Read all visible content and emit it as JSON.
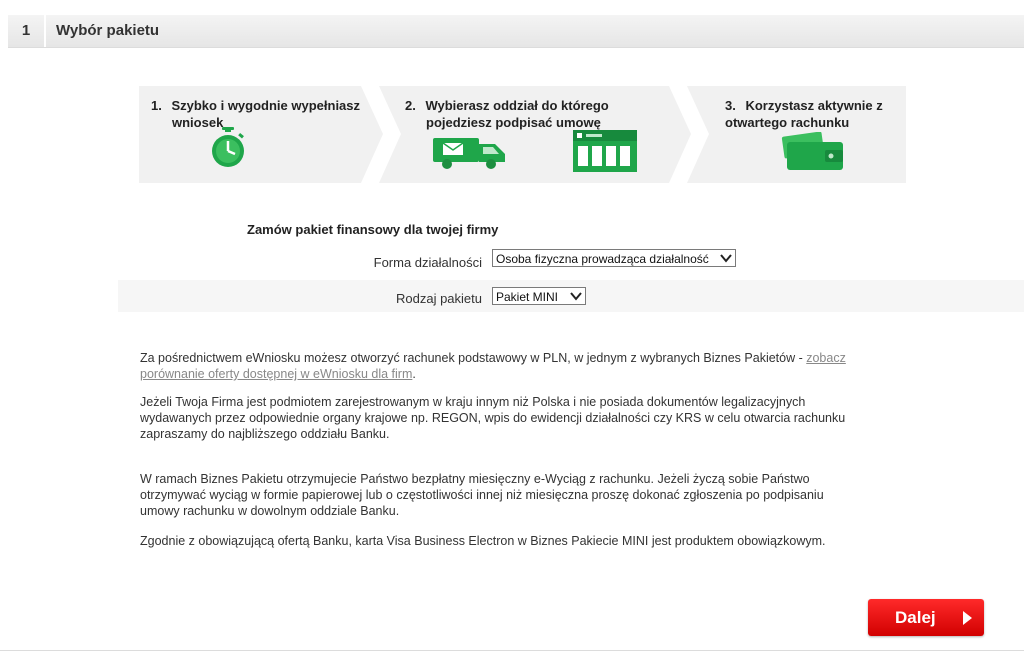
{
  "section": {
    "number": "1",
    "title": "Wybór pakietu"
  },
  "steps": [
    {
      "num": "1.",
      "line1": "Szybko i wygodnie wypełniasz",
      "line2": "wniosek"
    },
    {
      "num": "2.",
      "line1": "Wybierasz oddział do którego",
      "line2": "pojedziesz podpisać umowę"
    },
    {
      "num": "3.",
      "line1": "Korzystasz aktywnie z",
      "line2": "otwartego rachunku"
    }
  ],
  "form": {
    "title": "Zamów pakiet finansowy dla twojej firmy",
    "business_form_label": "Forma działalności",
    "business_form_value": "Osoba fizyczna prowadząca działalność",
    "package_label": "Rodzaj pakietu",
    "package_value": "Pakiet MINI"
  },
  "paragraphs": {
    "p1_text": "Za pośrednictwem eWniosku możesz otworzyć rachunek podstawowy w PLN, w jednym z wybranych Biznes Pakietów - ",
    "p1_link_a": "zobacz",
    "p1_link_b": "porównanie oferty dostępnej w eWniosku dla firm",
    "p1_end": ".",
    "p2_l1": "Jeżeli Twoja Firma jest podmiotem zarejestrowanym w kraju innym niż Polska i nie posiada dokumentów legalizacyjnych",
    "p2_l2": "wydawanych przez odpowiednie organy krajowe np. REGON, wpis do ewidencji działalności czy KRS w celu otwarcia rachunku",
    "p2_l3": "zapraszamy do najbliższego oddziału Banku.",
    "p3_l1": "W ramach Biznes Pakietu otrzymujecie Państwo bezpłatny miesięczny e-Wyciąg z rachunku. Jeżeli życzą sobie Państwo",
    "p3_l2": "otrzymywać wyciąg w formie papierowej lub o częstotliwości innej niż miesięczna proszę dokonać zgłoszenia po podpisaniu",
    "p3_l3": "umowy rachunku w dowolnym oddziale Banku.",
    "p4": "Zgodnie z obowiązującą ofertą Banku, karta Visa Business Electron w Biznes Pakiecie MINI jest produktem obowiązkowym."
  },
  "next_button": {
    "label": "Dalej"
  },
  "colors": {
    "accent_green": "#1fa64a",
    "button_red": "#e60000"
  },
  "icons": [
    "stopwatch-icon",
    "delivery-van-icon",
    "bank-branch-icon",
    "wallet-icon",
    "chevron-down-icon",
    "arrow-right-icon"
  ]
}
